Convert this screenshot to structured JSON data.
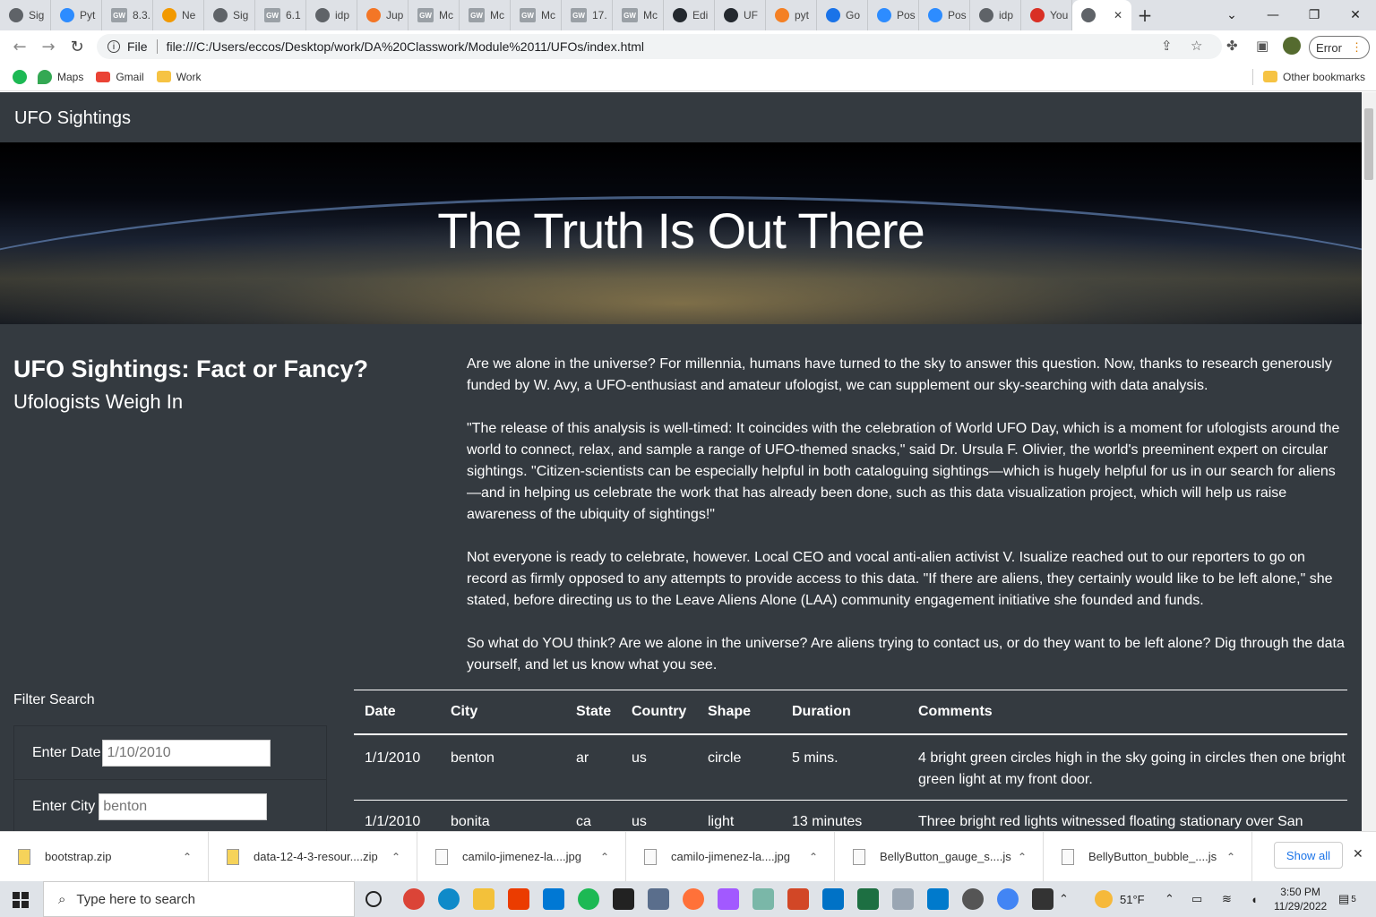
{
  "browser": {
    "tabs": [
      {
        "label": "Sig",
        "color": "#5f6368"
      },
      {
        "label": "Pyt",
        "color": "#2d8cff"
      },
      {
        "label": "8.3.",
        "color": "#9aa0a6",
        "gw": "GW"
      },
      {
        "label": "Ne",
        "color": "#f29900"
      },
      {
        "label": "Sig",
        "color": "#5f6368"
      },
      {
        "label": "6.1",
        "color": "#9aa0a6",
        "gw": "GW"
      },
      {
        "label": "idp",
        "color": "#5f6368"
      },
      {
        "label": "Jup",
        "color": "#f37626"
      },
      {
        "label": "Mc",
        "color": "#9aa0a6",
        "gw": "GW"
      },
      {
        "label": "Mc",
        "color": "#9aa0a6",
        "gw": "GW"
      },
      {
        "label": "Mc",
        "color": "#9aa0a6",
        "gw": "GW"
      },
      {
        "label": "17.",
        "color": "#9aa0a6",
        "gw": "GW"
      },
      {
        "label": "Mc",
        "color": "#9aa0a6",
        "gw": "GW"
      },
      {
        "label": "Edi",
        "color": "#24292f"
      },
      {
        "label": "UF",
        "color": "#24292f"
      },
      {
        "label": "pyt",
        "color": "#f48024"
      },
      {
        "label": "Go",
        "color": "#1a73e8"
      },
      {
        "label": "Pos",
        "color": "#2d8cff"
      },
      {
        "label": "Pos",
        "color": "#2d8cff"
      },
      {
        "label": "idp",
        "color": "#5f6368"
      },
      {
        "label": "You",
        "color": "#d93025"
      }
    ],
    "active_tab_close": "✕",
    "new_tab": "+",
    "url_scheme": "File",
    "url": "file:///C:/Users/eccos/Desktop/work/DA%20Classwork/Module%2011/UFOs/index.html",
    "error_label": "Error",
    "bookmarks": [
      "Maps",
      "Gmail",
      "Work"
    ],
    "other_bookmarks": "Other bookmarks"
  },
  "page": {
    "brand": "UFO Sightings",
    "hero_title": "The Truth Is Out There",
    "left_title": "UFO Sightings: Fact or Fancy?",
    "left_subtitle": "Ufologists Weigh In",
    "paragraphs": [
      "Are we alone in the universe? For millennia, humans have turned to the sky to answer this question. Now, thanks to research generously funded by W. Avy, a UFO-enthusiast and amateur ufologist, we can supplement our sky-searching with data analysis.",
      "\"The release of this analysis is well-timed: It coincides with the celebration of World UFO Day, which is a moment for ufologists around the world to connect, relax, and sample a range of UFO-themed snacks,\" said Dr. Ursula F. Olivier, the world's preeminent expert on circular sightings. \"Citizen-scientists can be especially helpful in both cataloguing sightings—which is hugely helpful for us in our search for aliens—and in helping us celebrate the work that has already been done, such as this data visualization project, which will help us raise awareness of the ubiquity of sightings!\"",
      "Not everyone is ready to celebrate, however. Local CEO and vocal anti-alien activist V. Isualize reached out to our reporters to go on record as firmly opposed to any attempts to provide access to this data. \"If there are aliens, they certainly would like to be left alone,\" she stated, before directing us to the Leave Aliens Alone (LAA) community engagement initiative she founded and funds.",
      "So what do YOU think? Are we alone in the universe? Are aliens trying to contact us, or do they want to be left alone? Dig through the data yourself, and let us know what you see."
    ],
    "filter_title": "Filter Search",
    "filters": [
      {
        "label": "Enter Date",
        "placeholder": "1/10/2010"
      },
      {
        "label": "Enter City",
        "placeholder": "benton"
      }
    ],
    "table": {
      "headers": [
        "Date",
        "City",
        "State",
        "Country",
        "Shape",
        "Duration",
        "Comments"
      ],
      "rows": [
        [
          "1/1/2010",
          "benton",
          "ar",
          "us",
          "circle",
          "5 mins.",
          "4 bright green circles high in the sky going in circles then one bright green light at my front door."
        ],
        [
          "1/1/2010",
          "bonita",
          "ca",
          "us",
          "light",
          "13 minutes",
          "Three bright red lights witnessed floating stationary over San"
        ]
      ]
    }
  },
  "downloads": {
    "items": [
      "bootstrap.zip",
      "data-12-4-3-resour....zip",
      "camilo-jimenez-la....jpg",
      "camilo-jimenez-la....jpg",
      "BellyButton_gauge_s....js",
      "BellyButton_bubble_....js"
    ],
    "show_all": "Show all",
    "close": "✕"
  },
  "taskbar": {
    "search_placeholder": "Type here to search",
    "weather": "51°F",
    "time": "3:50 PM",
    "date": "11/29/2022",
    "notifications": "5"
  }
}
